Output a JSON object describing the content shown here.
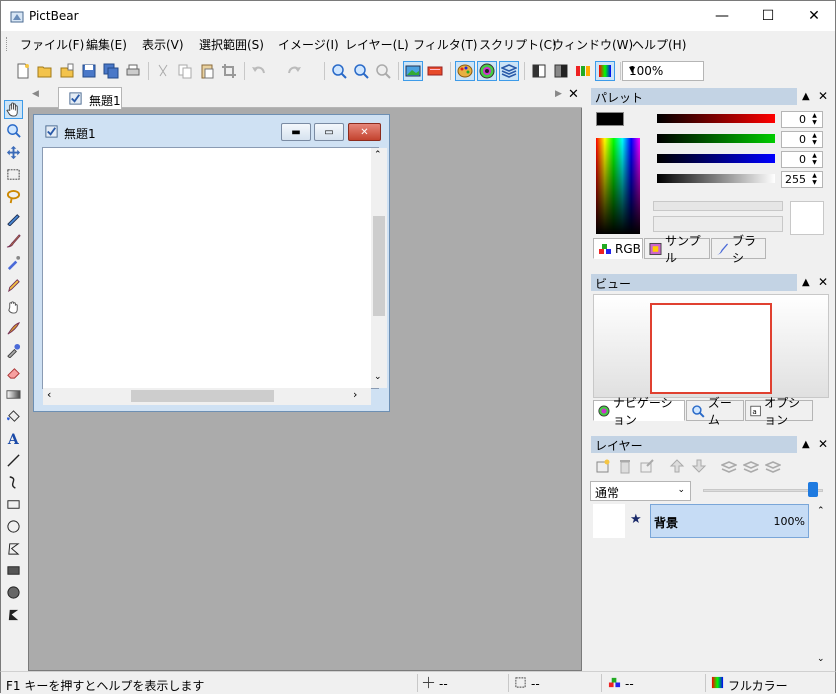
{
  "window": {
    "title": "PictBear",
    "minimize": "—",
    "maximize": "☐",
    "close": "✕"
  },
  "menu": [
    "ファイル(F)",
    "編集(E)",
    "表示(V)",
    "選択範囲(S)",
    "イメージ(I)",
    "レイヤー(L)",
    "フィルタ(T)",
    "スクリプト(C)",
    "ウィンドウ(W)",
    "ヘルプ(H)"
  ],
  "toolbar": {
    "zoom": "100%"
  },
  "document": {
    "tab_label": "無題1",
    "window_title": "無題1"
  },
  "palette": {
    "title": "パレット",
    "r": "0",
    "g": "0",
    "b": "0",
    "a": "255",
    "tabs": [
      "RGB",
      "サンプル",
      "ブラシ"
    ]
  },
  "view": {
    "title": "ビュー",
    "tabs": [
      "ナビゲーション",
      "ズーム",
      "オプション"
    ]
  },
  "layers": {
    "title": "レイヤー",
    "blend_mode": "通常",
    "items": [
      {
        "name": "背景",
        "opacity": "100%"
      }
    ]
  },
  "status": {
    "help": "F1 キーを押すとヘルプを表示します",
    "pos": "--",
    "size": "--",
    "color": "--",
    "mode": "フルカラー"
  },
  "colors": {
    "accent": "#3d9be9",
    "layer_selected": "#c6dcf5",
    "panel_head": "#c3d3e4"
  }
}
